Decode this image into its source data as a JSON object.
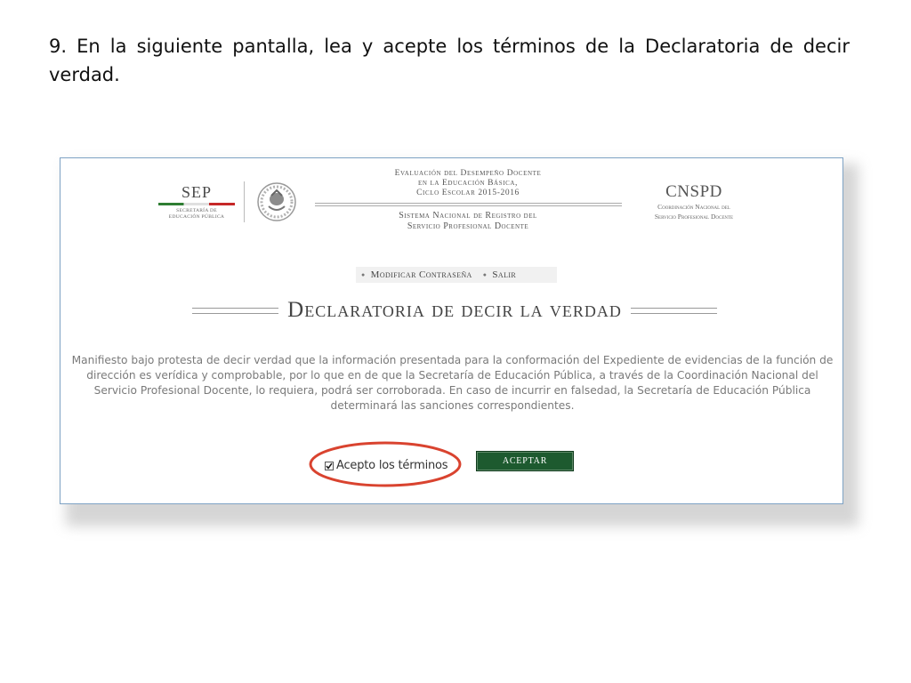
{
  "slide": {
    "instruction": "9. En la siguiente pantalla, lea y acepte los términos de la Declaratoria de decir verdad."
  },
  "header": {
    "sep_logo": "SEP",
    "sep_sub_1": "SECRETARÍA DE",
    "sep_sub_2": "EDUCACIÓN PÚBLICA",
    "eval_line_1": "Evaluación del Desempeño Docente",
    "eval_line_2": "en la Educación Básica,",
    "eval_line_3": "Ciclo Escolar 2015-2016",
    "system_line_1": "Sistema Nacional de Registro del",
    "system_line_2": "Servicio Profesional Docente",
    "cnspd_title": "CNSPD",
    "cnspd_sub_1": "Coordinación Nacional del",
    "cnspd_sub_2": "Servicio Profesional Docente"
  },
  "nav": {
    "change_password": "Modificar Contraseña",
    "logout": "Salir"
  },
  "page": {
    "title": "Declaratoria de decir la verdad",
    "declaration": "Manifiesto bajo protesta de decir verdad que la información presentada para la conformación del Expediente de evidencias de la función de dirección es verídica y comprobable, por lo que en de que la Secretaría de Educación Pública, a través de la Coordinación Nacional del Servicio Profesional Docente, lo requiera, podrá ser corroborada. En caso de incurrir en falsedad, la Secretaría de Educación Pública determinará las sanciones correspondientes."
  },
  "form": {
    "accept_terms_label": "Acepto los términos",
    "accept_terms_checked": true,
    "accept_button": "ACEPTAR"
  },
  "colors": {
    "button_green": "#1d5a2f",
    "highlight_red": "#d9432f",
    "frame_blue": "#7ea2c4"
  }
}
